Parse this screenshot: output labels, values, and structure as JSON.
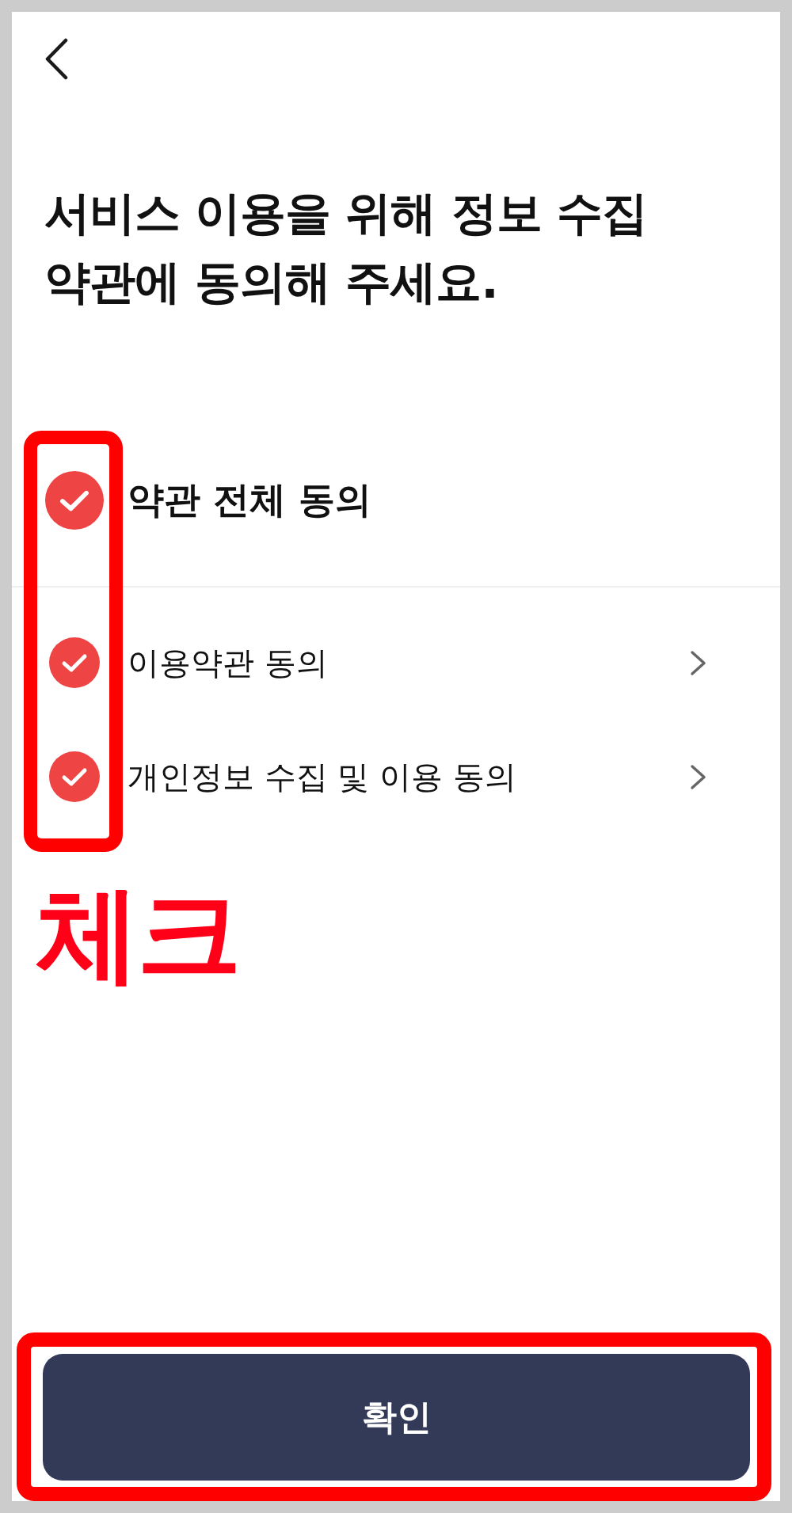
{
  "title": "서비스 이용을 위해 정보 수집 약관에 동의해 주세요.",
  "agree_all": {
    "label": "약관 전체 동의",
    "checked": true
  },
  "items": [
    {
      "label": "이용약관 동의",
      "checked": true
    },
    {
      "label": "개인정보 수집 및 이용 동의",
      "checked": true
    }
  ],
  "annotation": {
    "text": "체크"
  },
  "confirm_button": {
    "label": "확인"
  }
}
